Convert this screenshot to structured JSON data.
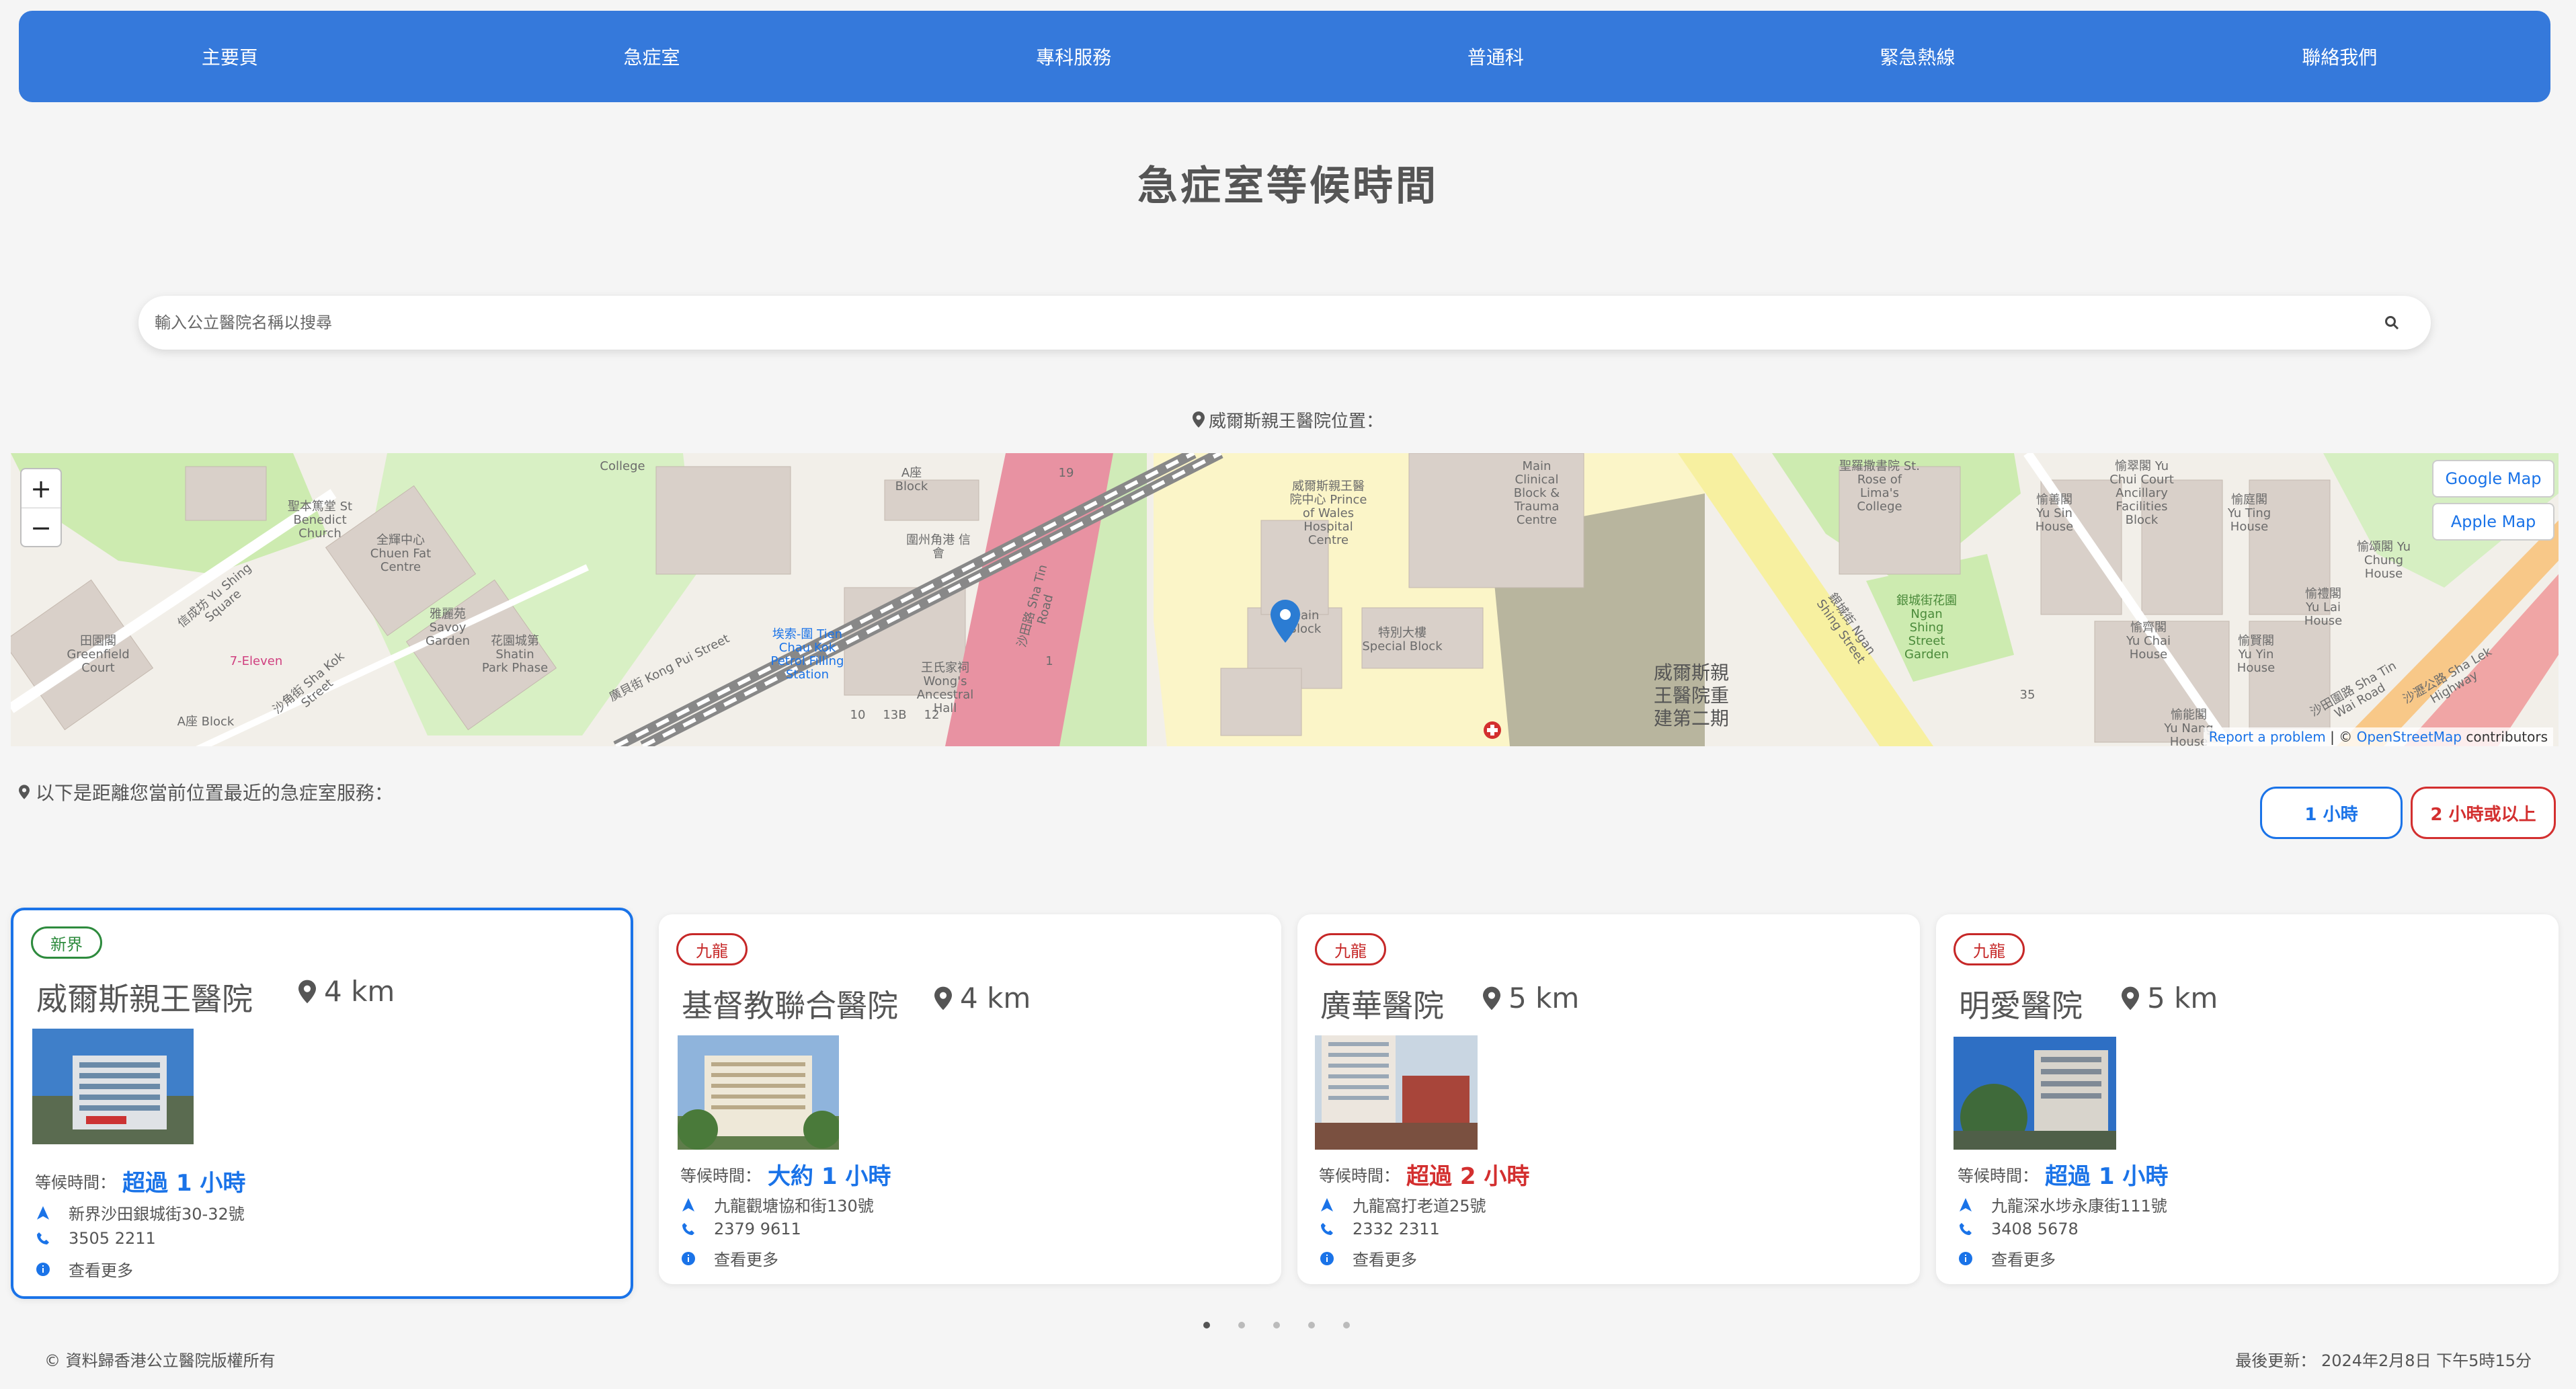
{
  "nav": {
    "items": [
      "主要頁",
      "急症室",
      "專科服務",
      "普通科",
      "緊急熱線",
      "聯絡我們"
    ]
  },
  "page_title": "急症室等候時間",
  "search": {
    "placeholder": "輸入公立醫院名稱以搜尋",
    "value": ""
  },
  "location_label": "威爾斯親王醫院位置：",
  "map": {
    "google_button": "Google Map",
    "apple_button": "Apple Map",
    "zoom_in": "+",
    "zoom_out": "−",
    "attribution_report": "Report a problem",
    "attribution_sep": " | © ",
    "attribution_osm": "OpenStreetMap",
    "attribution_tail": " contributors",
    "labels": {
      "main_block": "Main Block",
      "special_block": "特別大樓 Special Block",
      "phase2": "威爾斯親王醫院重建第二期",
      "clinical_block": "Main Clinical Block & Trauma Centre",
      "kong_pui": "廣貝街 Kong Pui Street",
      "sha_tin_road": "沙田路 Sha Tin Road",
      "ngan_shing": "銀城街 Ngan Shing Street",
      "st_rose": "聖羅撒書院 St. Rose of Lima's College",
      "college": "College",
      "wongs_hall": "王氏家祠 Wong's Ancestral Hall",
      "pow_cafe": "威爾斯親王醫院中心 Prince of Wales Hospital Centre",
      "yu_sin": "愉善閣 Yu Sin House",
      "yu_ting": "愉庭閣 Yu Ting House",
      "yu_chung": "愉頌閣 Yu Chung House",
      "yu_lai": "愉禮閣 Yu Lai House",
      "yu_yin": "愉賢閣 Yu Yin House",
      "yu_nang": "愉能閣 Yu Nang House",
      "yu_chai": "愉齊閣 Yu Chai House",
      "sha_tin_wai": "沙田圍路 Sha Tin Wai Road",
      "sha_lek": "沙瀝公路 Sha Lek Highway",
      "chuen_fat": "全輝中心 Chuen Fat Centre",
      "savoy": "雅麗苑 Savoy Garden",
      "shatin_park": "花園城第 Shatin Park Phase",
      "greenfield": "田園閣 Greenfield Court",
      "a_block": "A座 Block",
      "st_benedict": "聖本篤堂 St Benedict Church",
      "shing_square": "信成坊 Yu Shing Square",
      "seven_eleven": "7-Eleven",
      "sha_kok": "沙角街 Sha Kok Street",
      "petrol": "埃索-圍 Tien Chau Kok Petrol Filling Station",
      "ngan_garden": "銀城街花園 Ngan Shing Street Garden",
      "yu_chui": "愉翠閣 Yu Chui Court Ancillary Facilities Block",
      "wai_chau": "圍州角港 信會",
      "num_19": "19",
      "num_35": "35",
      "num_13b": "13B",
      "num_10": "10",
      "num_12": "12",
      "num_1": "1"
    }
  },
  "nearest_label": "以下是距離您當前位置最近的急症室服務：",
  "filters": {
    "one_hour": "1 小時",
    "two_hours": "2 小時或以上"
  },
  "cards": [
    {
      "region": "新界",
      "name": "威爾斯親王醫院",
      "distance": "4 km",
      "wait_label": "等候時間：",
      "wait": "超過 1 小時",
      "address": "新界沙田銀城街30-32號",
      "phone": "3505 2211",
      "more": "查看更多"
    },
    {
      "region": "九龍",
      "name": "基督教聯合醫院",
      "distance": "4 km",
      "wait_label": "等候時間：",
      "wait": "大約 1 小時",
      "address": "九龍觀塘協和街130號",
      "phone": "2379 9611",
      "more": "查看更多"
    },
    {
      "region": "九龍",
      "name": "廣華醫院",
      "distance": "5 km",
      "wait_label": "等候時間：",
      "wait": "超過 2 小時",
      "address": "九龍窩打老道25號",
      "phone": "2332 2311",
      "more": "查看更多"
    },
    {
      "region": "九龍",
      "name": "明愛醫院",
      "distance": "5 km",
      "wait_label": "等候時間：",
      "wait": "超過 1 小時",
      "address": "九龍深水埗永康街111號",
      "phone": "3408 5678",
      "more": "查看更多"
    }
  ],
  "footer": {
    "copyright": "© 資料歸香港公立醫院版權所有",
    "last_update": "最後更新： 2024年2月8日 下午5時15分"
  },
  "colors": {
    "nav_bg": "#3579db",
    "accent_blue": "#1a73e8",
    "accent_red": "#d32f2f",
    "region_green": "#2e8b3e",
    "region_red": "#c62828"
  },
  "pagination": {
    "pages": 5,
    "current": 1
  }
}
